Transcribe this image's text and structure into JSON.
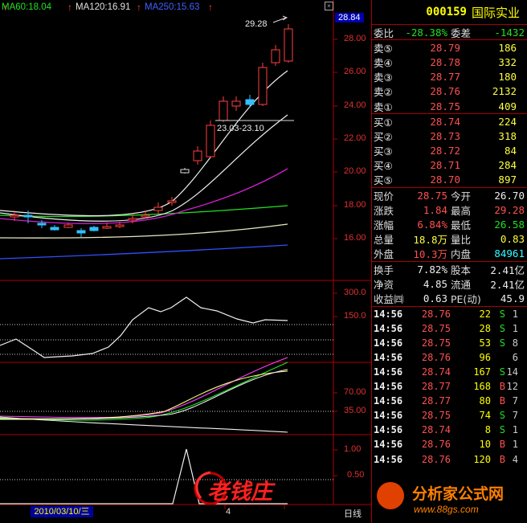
{
  "indicators": {
    "ma60": "MA60:18.04",
    "ma120": "MA120:16.91",
    "ma250": "MA250:15.63",
    "ma60_color": "#22e022",
    "ma120_color": "#e0e0e0",
    "ma250_color": "#4060ff"
  },
  "chart": {
    "current_price_tag": "28.84",
    "price_ticks": [
      "28.00",
      "26.00",
      "24.00",
      "22.00",
      "20.00",
      "18.00",
      "16.00"
    ],
    "high_label": "29.28",
    "range_label": "23.03-23.10",
    "vol_ticks": [
      "300.0",
      "150.0"
    ],
    "ind2_ticks": [
      "70.00",
      "35.00"
    ],
    "ind3_ticks": [
      "1.00",
      "0.50"
    ],
    "cursor_date": "2010/03/10/三",
    "axis_mark": "4",
    "period": "日线",
    "watermark_left": "老钱庄",
    "watermark_right_cn": "分析家公式网",
    "watermark_right_url": "www.88gs.com"
  },
  "quote": {
    "code": "000159",
    "name": "国际实业",
    "weibi_label": "委比",
    "weibi_value": "-28.38%",
    "weicha_label": "委差",
    "weicha_value": "-1432",
    "asks": [
      {
        "label": "卖⑤",
        "price": "28.79",
        "vol": "186"
      },
      {
        "label": "卖④",
        "price": "28.78",
        "vol": "332"
      },
      {
        "label": "卖③",
        "price": "28.77",
        "vol": "180"
      },
      {
        "label": "卖②",
        "price": "28.76",
        "vol": "2132"
      },
      {
        "label": "卖①",
        "price": "28.75",
        "vol": "409"
      }
    ],
    "bids": [
      {
        "label": "买①",
        "price": "28.74",
        "vol": "224"
      },
      {
        "label": "买②",
        "price": "28.73",
        "vol": "318"
      },
      {
        "label": "买③",
        "price": "28.72",
        "vol": "84"
      },
      {
        "label": "买④",
        "price": "28.71",
        "vol": "284"
      },
      {
        "label": "买⑤",
        "price": "28.70",
        "vol": "897"
      }
    ],
    "stats1": [
      {
        "l1": "现价",
        "v1": "28.75",
        "l2": "今开",
        "v2": "26.70"
      },
      {
        "l1": "涨跌",
        "v1": "1.84",
        "l2": "最高",
        "v2": "29.28"
      },
      {
        "l1": "涨幅",
        "v1": "6.84%",
        "l2": "最低",
        "v2": "26.58"
      },
      {
        "l1": "总量",
        "v1": "18.8万",
        "l2": "量比",
        "v2": "0.83"
      },
      {
        "l1": "外盘",
        "v1": "10.3万",
        "l2": "内盘",
        "v2": "84961"
      }
    ],
    "stats2": [
      {
        "l1": "换手",
        "v1": "7.82%",
        "l2": "股本",
        "v2": "2.41亿"
      },
      {
        "l1": "净资",
        "v1": "4.85",
        "l2": "流通",
        "v2": "2.41亿"
      },
      {
        "l1": "收益㈣",
        "v1": "0.63",
        "l2": "PE(动)",
        "v2": "45.9"
      }
    ],
    "ticks": [
      {
        "time": "14:56",
        "price": "28.76",
        "vol": "22",
        "side": "S",
        "extra": "1"
      },
      {
        "time": "14:56",
        "price": "28.75",
        "vol": "28",
        "side": "S",
        "extra": "1"
      },
      {
        "time": "14:56",
        "price": "28.75",
        "vol": "53",
        "side": "S",
        "extra": "8"
      },
      {
        "time": "14:56",
        "price": "28.76",
        "vol": "96",
        "side": "",
        "extra": "6"
      },
      {
        "time": "14:56",
        "price": "28.74",
        "vol": "167",
        "side": "S",
        "extra": "14"
      },
      {
        "time": "14:56",
        "price": "28.77",
        "vol": "168",
        "side": "B",
        "extra": "12"
      },
      {
        "time": "14:56",
        "price": "28.77",
        "vol": "80",
        "side": "B",
        "extra": "7"
      },
      {
        "time": "14:56",
        "price": "28.75",
        "vol": "74",
        "side": "S",
        "extra": "7"
      },
      {
        "time": "14:56",
        "price": "28.74",
        "vol": "8",
        "side": "S",
        "extra": "1"
      },
      {
        "time": "14:56",
        "price": "28.76",
        "vol": "10",
        "side": "B",
        "extra": "1"
      },
      {
        "time": "14:56",
        "price": "28.76",
        "vol": "120",
        "side": "B",
        "extra": "4"
      }
    ]
  }
}
